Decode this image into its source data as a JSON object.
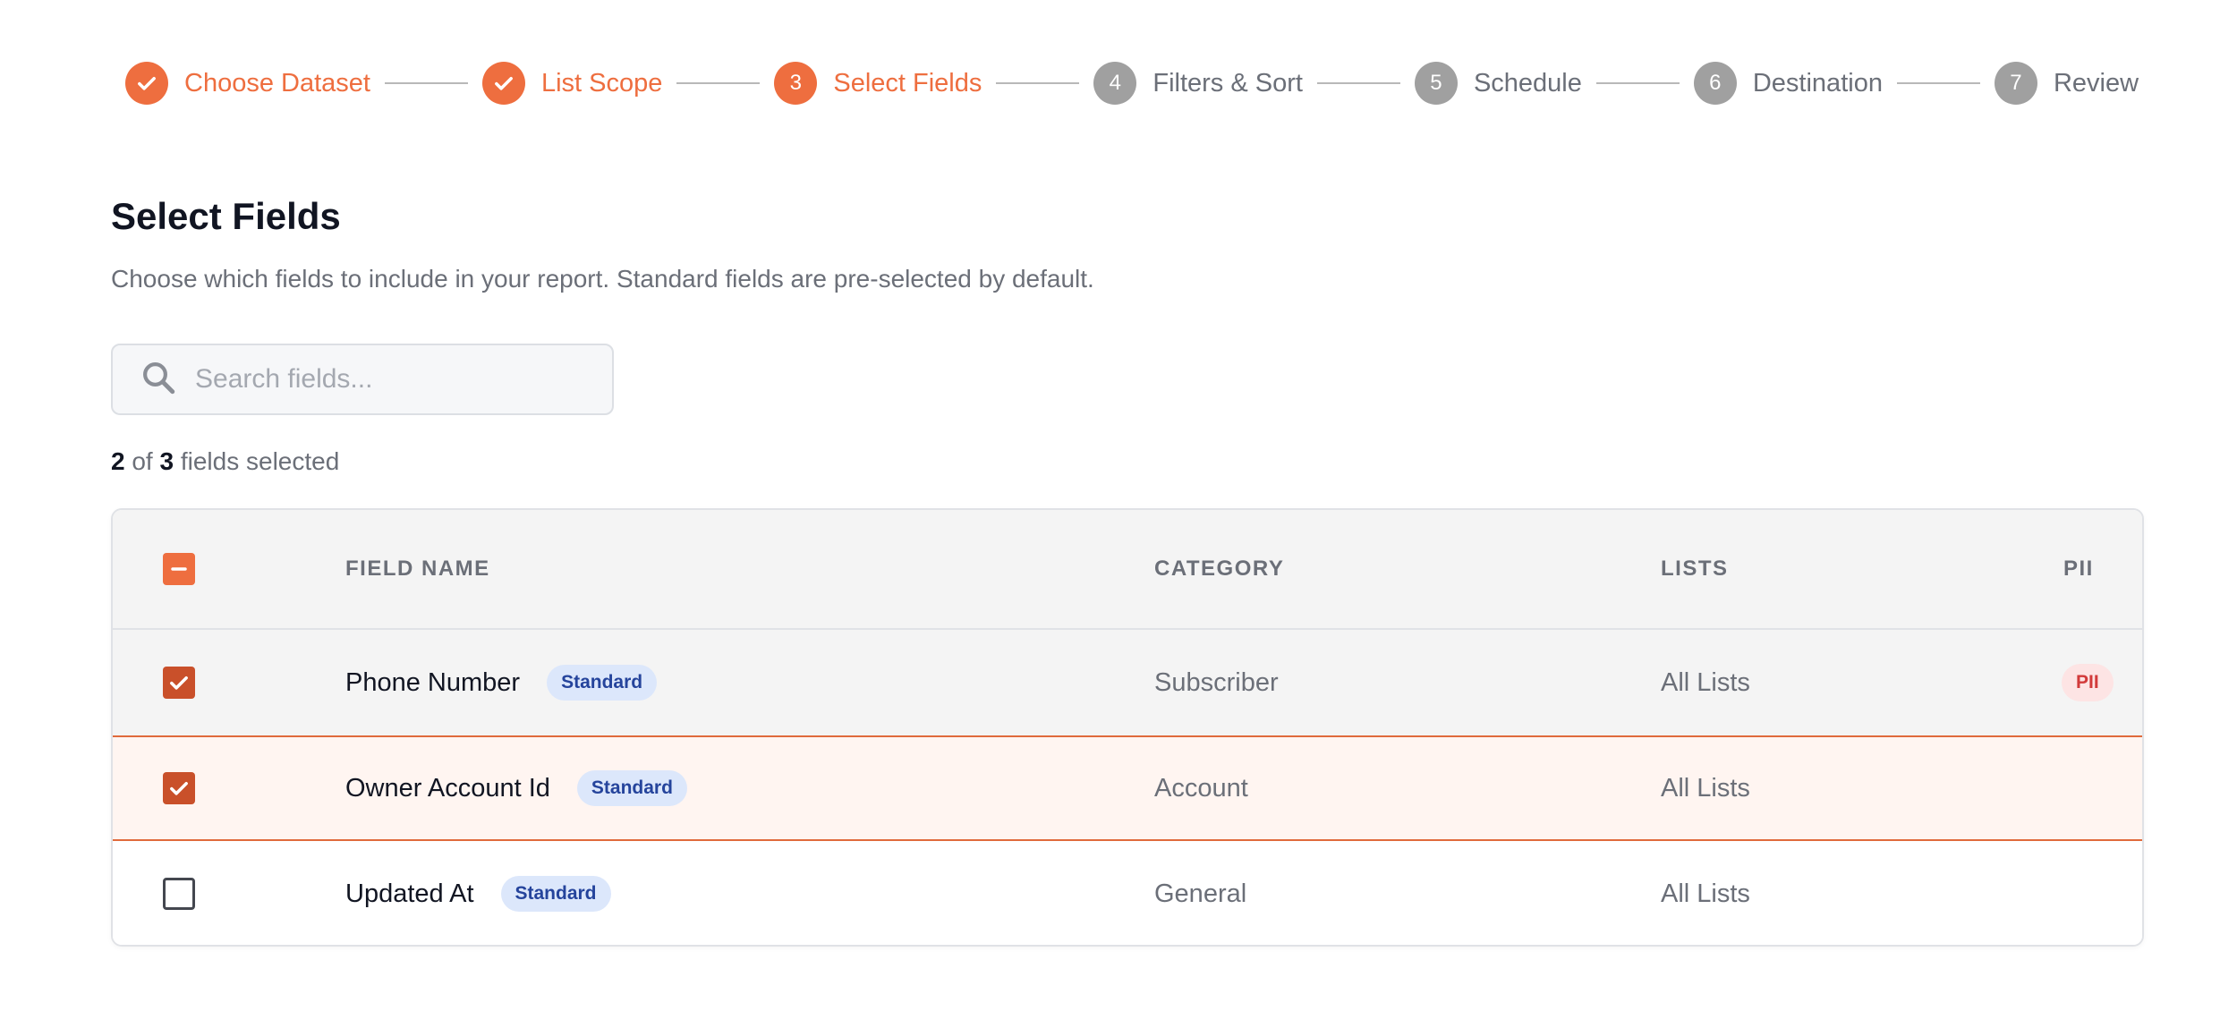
{
  "stepper": {
    "steps": [
      {
        "number": "1",
        "label": "Choose Dataset",
        "status": "done"
      },
      {
        "number": "2",
        "label": "List Scope",
        "status": "done"
      },
      {
        "number": "3",
        "label": "Select Fields",
        "status": "active"
      },
      {
        "number": "4",
        "label": "Filters & Sort",
        "status": "pending"
      },
      {
        "number": "5",
        "label": "Schedule",
        "status": "pending"
      },
      {
        "number": "6",
        "label": "Destination",
        "status": "pending"
      },
      {
        "number": "7",
        "label": "Review",
        "status": "pending"
      }
    ]
  },
  "header": {
    "title": "Select Fields",
    "subtitle": "Choose which fields to include in your report. Standard fields are pre-selected by default."
  },
  "search": {
    "placeholder": "Search fields...",
    "value": "",
    "icon": "search-icon"
  },
  "selection": {
    "selected": "2",
    "of_text": "of",
    "total": "3",
    "suffix": "fields selected"
  },
  "table": {
    "columns": {
      "field_name": "FIELD NAME",
      "category": "CATEGORY",
      "lists": "LISTS",
      "pii": "PII"
    },
    "select_all_state": "indeterminate",
    "rows": [
      {
        "name": "Phone Number",
        "badge": "Standard",
        "category": "Subscriber",
        "lists": "All Lists",
        "pii": "PII",
        "checked": true
      },
      {
        "name": "Owner Account Id",
        "badge": "Standard",
        "category": "Account",
        "lists": "All Lists",
        "pii": "",
        "checked": true
      },
      {
        "name": "Updated At",
        "badge": "Standard",
        "category": "General",
        "lists": "All Lists",
        "pii": "",
        "checked": false
      }
    ]
  },
  "colors": {
    "accent": "#ee6e3f",
    "checkbox_checked": "#c9502a",
    "pending_step": "#a0a0a0",
    "badge_standard_bg": "#dce7fb",
    "badge_standard_text": "#25449c",
    "badge_pii_bg": "#fde4e4",
    "badge_pii_text": "#d23b3b",
    "focused_row_bg": "#fff5f1",
    "focused_row_border": "#e06a3c"
  }
}
